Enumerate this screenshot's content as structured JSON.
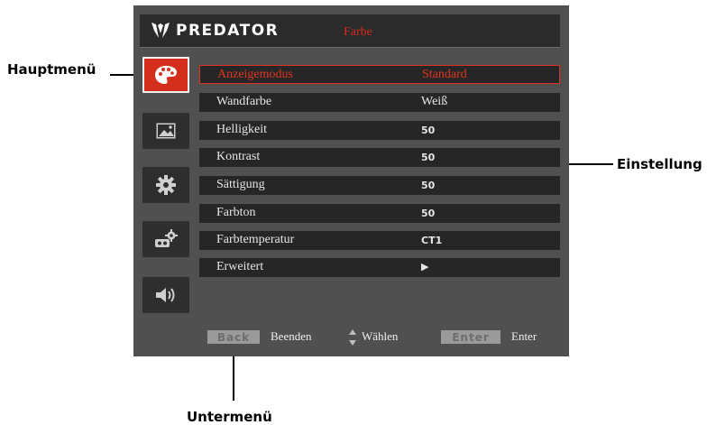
{
  "header": {
    "brand": "PREDATOR",
    "title": "Farbe"
  },
  "sidebar": {
    "items": [
      {
        "icon": "palette-icon",
        "active": true
      },
      {
        "icon": "image-icon",
        "active": false
      },
      {
        "icon": "gear-icon",
        "active": false
      },
      {
        "icon": "management-icon",
        "active": false
      },
      {
        "icon": "speaker-icon",
        "active": false
      }
    ]
  },
  "menu": {
    "rows": [
      {
        "label": "Anzeigemodus",
        "value": "Standard"
      },
      {
        "label": "Wandfarbe",
        "value": "Weiß"
      },
      {
        "label": "Helligkeit",
        "value": "50"
      },
      {
        "label": "Kontrast",
        "value": "50"
      },
      {
        "label": "Sättigung",
        "value": "50"
      },
      {
        "label": "Farbton",
        "value": "50"
      },
      {
        "label": "Farbtemperatur",
        "value": "CT1"
      },
      {
        "label": "Erweitert",
        "value": "▶"
      }
    ]
  },
  "footer": {
    "back_key": "Back",
    "back_label": "Beenden",
    "select_label": "Wählen",
    "enter_key": "Enter",
    "enter_label": "Enter"
  },
  "annotations": {
    "main_menu": "Hauptmenü",
    "setting": "Einstellung",
    "submenu": "Untermenü"
  },
  "colors": {
    "accent": "#d42e1c",
    "panel": "#505050",
    "row": "#262626"
  }
}
